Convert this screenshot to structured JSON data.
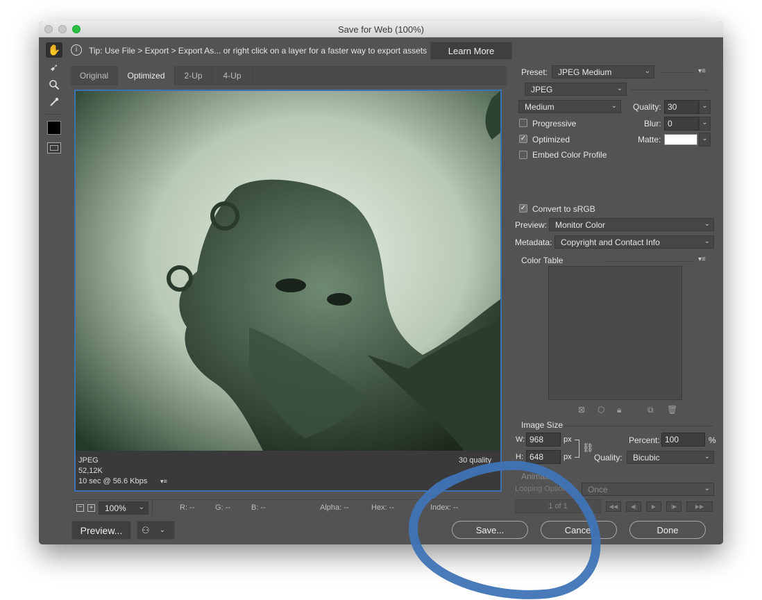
{
  "window": {
    "title": "Save for Web (100%)"
  },
  "tip": {
    "text": "Tip: Use File > Export > Export As...  or right click on a layer for a faster way to export assets",
    "learn_more": "Learn More"
  },
  "tabs": [
    "Original",
    "Optimized",
    "2-Up",
    "4-Up"
  ],
  "active_tab": "Optimized",
  "image_info": {
    "format": "JPEG",
    "size": "52,12K",
    "time": "10 sec @ 56.6 Kbps",
    "quality": "30 quality"
  },
  "statusbar": {
    "zoom": "100%",
    "r": "R: --",
    "g": "G: --",
    "b": "B: --",
    "alpha": "Alpha: --",
    "hex": "Hex: --",
    "index": "Index: --"
  },
  "settings": {
    "preset_label": "Preset:",
    "preset": "JPEG Medium",
    "format": "JPEG",
    "compression": "Medium",
    "quality_label": "Quality:",
    "quality": "30",
    "progressive": "Progressive",
    "progressive_checked": false,
    "blur_label": "Blur:",
    "blur": "0",
    "optimized": "Optimized",
    "optimized_checked": true,
    "matte_label": "Matte:",
    "matte_color": "#ffffff",
    "embed_profile": "Embed Color Profile",
    "embed_checked": false,
    "convert_srgb": "Convert to sRGB",
    "convert_checked": true,
    "preview_label": "Preview:",
    "preview": "Monitor Color",
    "metadata_label": "Metadata:",
    "metadata": "Copyright and Contact Info",
    "color_table": "Color Table"
  },
  "image_size": {
    "heading": "Image Size",
    "w_label": "W:",
    "w": "968",
    "h_label": "H:",
    "h": "648",
    "unit": "px",
    "percent_label": "Percent:",
    "percent": "100",
    "percent_unit": "%",
    "quality_label": "Quality:",
    "quality": "Bicubic"
  },
  "animation": {
    "heading": "Animation",
    "looping_label": "Looping Options:",
    "looping": "Once",
    "frame": "1 of 1"
  },
  "buttons": {
    "preview": "Preview...",
    "save": "Save...",
    "cancel": "Cancel",
    "done": "Done"
  },
  "colors": {
    "window_bg": "#535353",
    "image_border": "#3b72b5",
    "annotation": "#3f73b5",
    "foreground_swatch": "#000000"
  }
}
